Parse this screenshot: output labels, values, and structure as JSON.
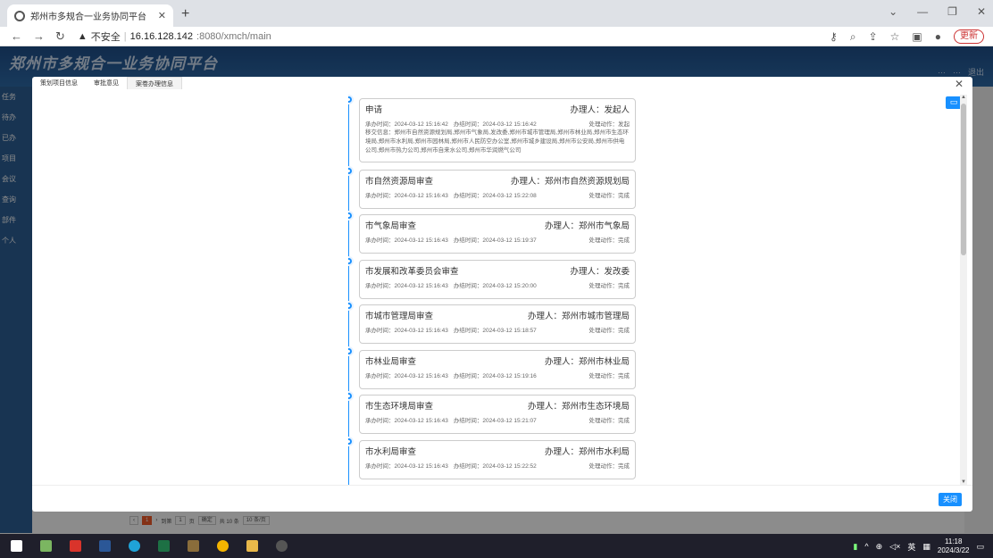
{
  "browser": {
    "tab_title": "郑州市多规合一业务协同平台",
    "url_warning": "不安全",
    "url_host": "16.16.128.142",
    "url_path": ":8080/xmch/main",
    "update_label": "更新"
  },
  "app": {
    "title": "郑州市多规合一业务协同平台",
    "header_links": [
      "…",
      "…",
      "退出"
    ],
    "sidebar": [
      "任务",
      "待办",
      "已办",
      "项目",
      "会议",
      "查询",
      "部件",
      "个人"
    ]
  },
  "modal": {
    "tabs": [
      "策划项目信息",
      "审批意见",
      "案卷办理信息"
    ],
    "active_tab": 2,
    "close_label": "关闭",
    "items": [
      {
        "step": "申请",
        "handler": "办理人：发起人",
        "received": "承办时间：2024-03-12 15:16:42",
        "handled": "办结时间：2024-03-12 15:16:42",
        "action": "处理动作：发起",
        "info": "移交信息：郑州市自然资源规划局,郑州市气象局,发改委,郑州市城市管理局,郑州市林业局,郑州市生态环境局,郑州市水利局,郑州市园林局,郑州市人民防空办公室,郑州市城乡建设局,郑州市公安局,郑州市供电公司,郑州市热力公司,郑州市自来水公司,郑州市华润燃气公司"
      },
      {
        "step": "市自然资源局审查",
        "handler": "办理人：郑州市自然资源规划局",
        "received": "承办时间：2024-03-12 15:16:43",
        "handled": "办结时间：2024-03-12 15:22:08",
        "action": "处理动作：完成",
        "info": ""
      },
      {
        "step": "市气象局审查",
        "handler": "办理人：郑州市气象局",
        "received": "承办时间：2024-03-12 15:16:43",
        "handled": "办结时间：2024-03-12 15:19:37",
        "action": "处理动作：完成",
        "info": ""
      },
      {
        "step": "市发展和改革委员会审查",
        "handler": "办理人：发改委",
        "received": "承办时间：2024-03-12 15:16:43",
        "handled": "办结时间：2024-03-12 15:20:00",
        "action": "处理动作：完成",
        "info": ""
      },
      {
        "step": "市城市管理局审查",
        "handler": "办理人：郑州市城市管理局",
        "received": "承办时间：2024-03-12 15:16:43",
        "handled": "办结时间：2024-03-12 15:18:57",
        "action": "处理动作：完成",
        "info": ""
      },
      {
        "step": "市林业局审查",
        "handler": "办理人：郑州市林业局",
        "received": "承办时间：2024-03-12 15:16:43",
        "handled": "办结时间：2024-03-12 15:19:16",
        "action": "处理动作：完成",
        "info": ""
      },
      {
        "step": "市生态环境局审查",
        "handler": "办理人：郑州市生态环境局",
        "received": "承办时间：2024-03-12 15:16:43",
        "handled": "办结时间：2024-03-12 15:21:07",
        "action": "处理动作：完成",
        "info": ""
      },
      {
        "step": "市水利局审查",
        "handler": "办理人：郑州市水利局",
        "received": "承办时间：2024-03-12 15:16:43",
        "handled": "办结时间：2024-03-12 15:22:52",
        "action": "处理动作：完成",
        "info": ""
      }
    ]
  },
  "pager": {
    "page": "1",
    "goto_prefix": "到第",
    "goto_value": "1",
    "goto_suffix": "页",
    "confirm": "确定",
    "total": "共 10 条",
    "per_page": "10 条/页"
  },
  "taskbar": {
    "ime": "英",
    "time": "11:18",
    "date": "2024/3/22"
  }
}
